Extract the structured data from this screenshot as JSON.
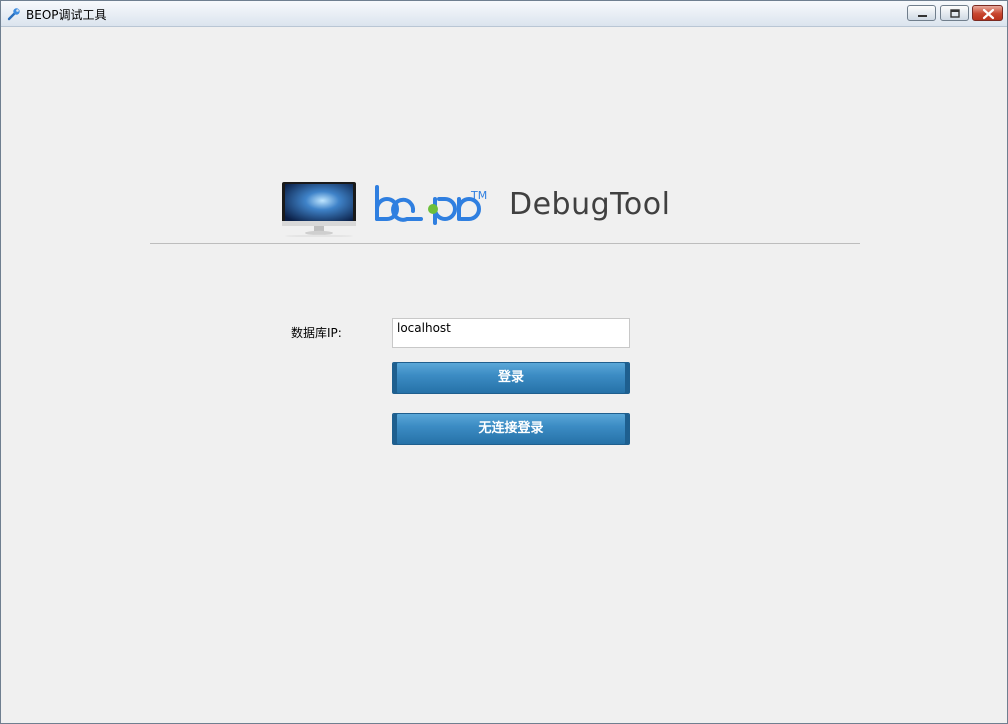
{
  "window": {
    "title": "BEOP调试工具",
    "icon": "wrench-icon"
  },
  "logo": {
    "brand": "beop",
    "trademark": "TM",
    "product": "DebugTool"
  },
  "login": {
    "ip_label": "数据库IP:",
    "ip_value": "localhost",
    "login_button": "登录",
    "offline_login_button": "无连接登录"
  },
  "colors": {
    "button_blue": "#2f80b8",
    "logo_blue": "#2f7fe0",
    "title_bar": "#dbe4ee",
    "close_red": "#c8462f"
  }
}
